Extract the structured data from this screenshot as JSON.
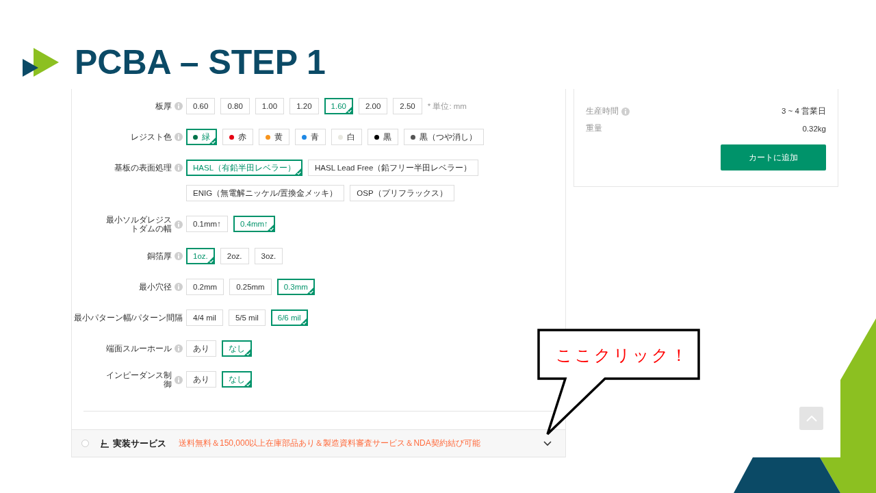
{
  "title": "PCBA – STEP 1",
  "spec_rows": [
    {
      "label": "板厚",
      "info": true,
      "options": [
        {
          "label": "0.60",
          "selected": false
        },
        {
          "label": "0.80",
          "selected": false
        },
        {
          "label": "1.00",
          "selected": false
        },
        {
          "label": "1.20",
          "selected": false
        },
        {
          "label": "1.60",
          "selected": true
        },
        {
          "label": "2.00",
          "selected": false
        },
        {
          "label": "2.50",
          "selected": false
        }
      ],
      "note": "* 単位: mm"
    },
    {
      "label": "レジスト色",
      "info": true,
      "options": [
        {
          "label": "緑",
          "selected": true,
          "color": "#00734a"
        },
        {
          "label": "赤",
          "selected": false,
          "color": "#e60012"
        },
        {
          "label": "黄",
          "selected": false,
          "color": "#f7941d"
        },
        {
          "label": "青",
          "selected": false,
          "color": "#1e88e5"
        },
        {
          "label": "白",
          "selected": false,
          "color": "#e8e8e0"
        },
        {
          "label": "黒",
          "selected": false,
          "color": "#000000"
        },
        {
          "label": "黒（つや消し）",
          "selected": false,
          "color": "#555555"
        }
      ]
    },
    {
      "label": "基板の表面処理",
      "info": true,
      "options": [
        {
          "label": "HASL（有鉛半田レベラー）",
          "selected": true
        },
        {
          "label": "HASL Lead Free（鉛フリー半田レベラー）",
          "selected": false
        },
        {
          "label": "ENIG（無電解ニッケル/置換金メッキ）",
          "selected": false
        },
        {
          "label": "OSP（プリフラックス）",
          "selected": false
        }
      ]
    },
    {
      "label": "最小ソルダレジストダムの幅",
      "info": true,
      "options": [
        {
          "label": "0.1mm↑",
          "selected": false
        },
        {
          "label": "0.4mm↑",
          "selected": true
        }
      ]
    },
    {
      "label": "銅箔厚",
      "info": true,
      "options": [
        {
          "label": "1oz.",
          "selected": true
        },
        {
          "label": "2oz.",
          "selected": false
        },
        {
          "label": "3oz.",
          "selected": false
        }
      ]
    },
    {
      "label": "最小穴径",
      "info": true,
      "options": [
        {
          "label": "0.2mm",
          "selected": false
        },
        {
          "label": "0.25mm",
          "selected": false
        },
        {
          "label": "0.3mm",
          "selected": true
        }
      ]
    },
    {
      "label": "最小パターン幅/パターン間隔",
      "info": false,
      "options": [
        {
          "label": "4/4 mil",
          "selected": false
        },
        {
          "label": "5/5 mil",
          "selected": false
        },
        {
          "label": "6/6 mil",
          "selected": true
        }
      ]
    },
    {
      "label": "端面スルーホール",
      "info": true,
      "options": [
        {
          "label": "あり",
          "selected": false
        },
        {
          "label": "なし",
          "selected": true
        }
      ]
    },
    {
      "label": "インピーダンス制御",
      "info": true,
      "options": [
        {
          "label": "あり",
          "selected": false
        },
        {
          "label": "なし",
          "selected": true
        }
      ]
    }
  ],
  "section": {
    "selected": false,
    "title": "実装サービス",
    "promo": "送料無料＆150,000以上在庫部品あり＆製造資料審査サービス＆NDA契約結び可能"
  },
  "summary": {
    "rows": [
      {
        "label": "生産時間",
        "info": true,
        "value": "3 ~ 4 営業日"
      },
      {
        "label": "重量",
        "info": false,
        "value": "0.32kg"
      }
    ],
    "button": "カートに追加"
  },
  "callout": "ここクリック！"
}
